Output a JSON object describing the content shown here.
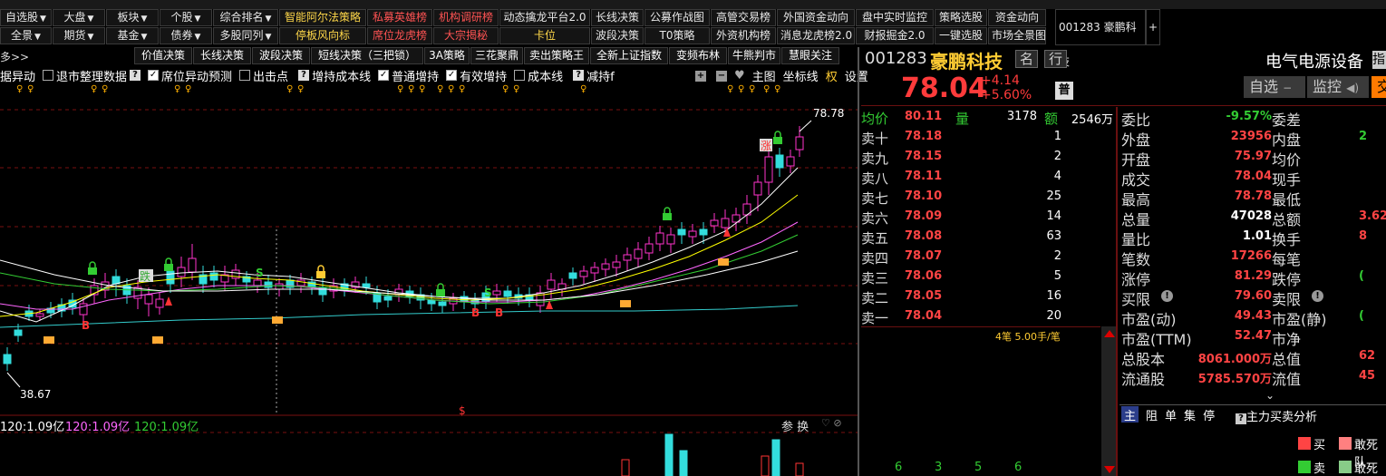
{
  "toolbar_row1": [
    {
      "label": "自选股",
      "dd": true
    },
    {
      "label": "大盘",
      "dd": true
    },
    {
      "label": "板块",
      "dd": true
    },
    {
      "label": "个股",
      "dd": true
    },
    {
      "label": "综合排名",
      "dd": true
    },
    {
      "label": "智能阿尔法策略",
      "color": "yellow"
    },
    {
      "label": "私募英雄榜",
      "color": "red"
    },
    {
      "label": "机构调研榜",
      "color": "red"
    },
    {
      "label": "动态擒龙平台2.0"
    },
    {
      "label": "长线决策"
    },
    {
      "label": "公募作战图"
    },
    {
      "label": "高管交易榜"
    },
    {
      "label": "外国资金动向"
    },
    {
      "label": "盘中实时监控"
    },
    {
      "label": "策略选股"
    },
    {
      "label": "资金动向"
    }
  ],
  "toolbar_row2": [
    {
      "label": "全景",
      "dd": true
    },
    {
      "label": "期货",
      "dd": true
    },
    {
      "label": "基金",
      "dd": true
    },
    {
      "label": "债券",
      "dd": true
    },
    {
      "label": "多股同列",
      "dd": true
    },
    {
      "label": "停板风向标",
      "color": "yellow"
    },
    {
      "label": "席位龙虎榜",
      "color": "red"
    },
    {
      "label": "大宗揭秘",
      "color": "red"
    },
    {
      "label": "卡位",
      "color": "yellow"
    },
    {
      "label": "波段决策"
    },
    {
      "label": "T0策略"
    },
    {
      "label": "外资机构榜"
    },
    {
      "label": "消息龙虎榜2.0"
    },
    {
      "label": "财报掘金2.0"
    },
    {
      "label": "一键选股"
    },
    {
      "label": "市场全景图"
    }
  ],
  "toolbar_row3": [
    "价值决策",
    "长线决策",
    "波段决策",
    "短线决策（三把锁）",
    "3A策略",
    "三花聚鼎",
    "卖出策略王",
    "全新上证指数",
    "变频布林",
    "牛熊判市",
    "慧眼关注"
  ],
  "stock_tab": {
    "label": "001283 豪鹏科技",
    "plus": "+"
  },
  "options": [
    {
      "label": "据异动",
      "checkbox": false,
      "shown_cb": false
    },
    {
      "label": "退市整理数据",
      "checkbox": false,
      "shown_cb": true,
      "q": true
    },
    {
      "label": "席位异动预测",
      "checkbox": true,
      "shown_cb": true
    },
    {
      "label": "出击点",
      "checkbox": false,
      "shown_cb": true
    },
    {
      "label": "增持成本线",
      "checkbox": false,
      "shown_cb": false,
      "q": true
    },
    {
      "label": "普通增持",
      "checkbox": true,
      "shown_cb": true
    },
    {
      "label": "有效增持",
      "checkbox": true,
      "shown_cb": true
    },
    {
      "label": "成本线",
      "checkbox": false,
      "shown_cb": true
    },
    {
      "label": "减持f",
      "checkbox": false,
      "shown_cb": false,
      "q": true
    }
  ],
  "chart_controls": {
    "zhutu": "主图",
    "zuobiao": "坐标线",
    "quan": "权",
    "shezhi": "设置"
  },
  "chart_left_label": "多>>",
  "chart_data": {
    "type": "candlestick",
    "high_label": "78.78",
    "low_label": "38.67",
    "signal_labels": [
      "S",
      "S",
      "B",
      "B",
      "B",
      "涨",
      "跌"
    ],
    "ma_colors": {
      "ma5": "#ffffff",
      "ma10": "#ffff00",
      "ma20": "#ff66ff",
      "ma60": "#33cc33",
      "ma120": "#33cccc"
    }
  },
  "lower_panel": {
    "ma_labels": [
      "120:1.09亿",
      "120:1.09亿",
      "120:1.09亿"
    ],
    "controls": "参 换",
    "dollar": "$"
  },
  "header": {
    "code": "001283",
    "name": "豪鹏科技",
    "tag1": "名",
    "tag2": "行",
    "industry": "电气电源设备",
    "price": "78.04",
    "change": "+4.14",
    "change_pct": "+5.60%",
    "badge": "普",
    "btn_zixuan": "自选",
    "btn_jiankong": "监控",
    "btn_jiao": "交"
  },
  "book_summary": {
    "junjia_label": "均价",
    "junjia": "80.11",
    "liang_label": "量",
    "liang": "3178",
    "e_label": "额",
    "e": "2546万"
  },
  "asks": [
    {
      "label": "卖十",
      "price": "78.18",
      "vol": "1"
    },
    {
      "label": "卖九",
      "price": "78.15",
      "vol": "2"
    },
    {
      "label": "卖八",
      "price": "78.11",
      "vol": "4"
    },
    {
      "label": "卖七",
      "price": "78.10",
      "vol": "25"
    },
    {
      "label": "卖六",
      "price": "78.09",
      "vol": "14"
    },
    {
      "label": "卖五",
      "price": "78.08",
      "vol": "63"
    },
    {
      "label": "卖四",
      "price": "78.07",
      "vol": "2"
    },
    {
      "label": "卖三",
      "price": "78.06",
      "vol": "5"
    },
    {
      "label": "卖二",
      "price": "78.05",
      "vol": "16"
    },
    {
      "label": "卖一",
      "price": "78.04",
      "vol": "20"
    }
  ],
  "tick_note": "4笔 5.00手/笔",
  "bottom_nums": [
    "6",
    "3",
    "5",
    "6"
  ],
  "stats": [
    {
      "l1": "委比",
      "v1": "-9.57%",
      "c1": "#33cc33",
      "l2": "委差",
      "v2": ""
    },
    {
      "l1": "外盘",
      "v1": "23956",
      "c1": "#ff4444",
      "l2": "内盘",
      "v2": "2"
    },
    {
      "l1": "开盘",
      "v1": "75.97",
      "c1": "#ff4444",
      "l2": "均价",
      "v2": ""
    },
    {
      "l1": "成交",
      "v1": "78.04",
      "c1": "#ff4444",
      "l2": "现手",
      "v2": ""
    },
    {
      "l1": "最高",
      "v1": "78.78",
      "c1": "#ff4444",
      "l2": "最低",
      "v2": ""
    },
    {
      "l1": "总量",
      "v1": "47028",
      "c1": "#ffffff",
      "l2": "总额",
      "v2": "3.62"
    },
    {
      "l1": "量比",
      "v1": "1.01",
      "c1": "#ffffff",
      "l2": "换手",
      "v2": "8"
    },
    {
      "l1": "笔数",
      "v1": "17266",
      "c1": "#ff4444",
      "l2": "每笔",
      "v2": ""
    },
    {
      "l1": "涨停",
      "v1": "81.29",
      "c1": "#ff4444",
      "l2": "跌停",
      "v2": "("
    },
    {
      "l1": "买限",
      "v1": "79.60",
      "c1": "#ff4444",
      "l2": "卖限",
      "v2": "",
      "info": true
    },
    {
      "l1": "市盈(动)",
      "v1": "49.43",
      "c1": "#ff4444",
      "l2": "市盈(静)",
      "v2": "("
    },
    {
      "l1": "市盈(TTM)",
      "v1": "52.47",
      "c1": "#ff4444",
      "l2": "市净",
      "v2": ""
    },
    {
      "l1": "总股本",
      "v1": "8061.000万",
      "c1": "#ff4444",
      "l2": "总值",
      "v2": "62"
    },
    {
      "l1": "流通股",
      "v1": "5785.570万",
      "c1": "#ff4444",
      "l2": "流值",
      "v2": "45"
    }
  ],
  "bottom_tabs": [
    "主",
    "阻",
    "单",
    "集",
    "停"
  ],
  "main_force": "主力买卖分析",
  "legend": {
    "buy": "买",
    "sell": "卖",
    "gansi1": "敢死队",
    "gansi2": "敢死队"
  }
}
